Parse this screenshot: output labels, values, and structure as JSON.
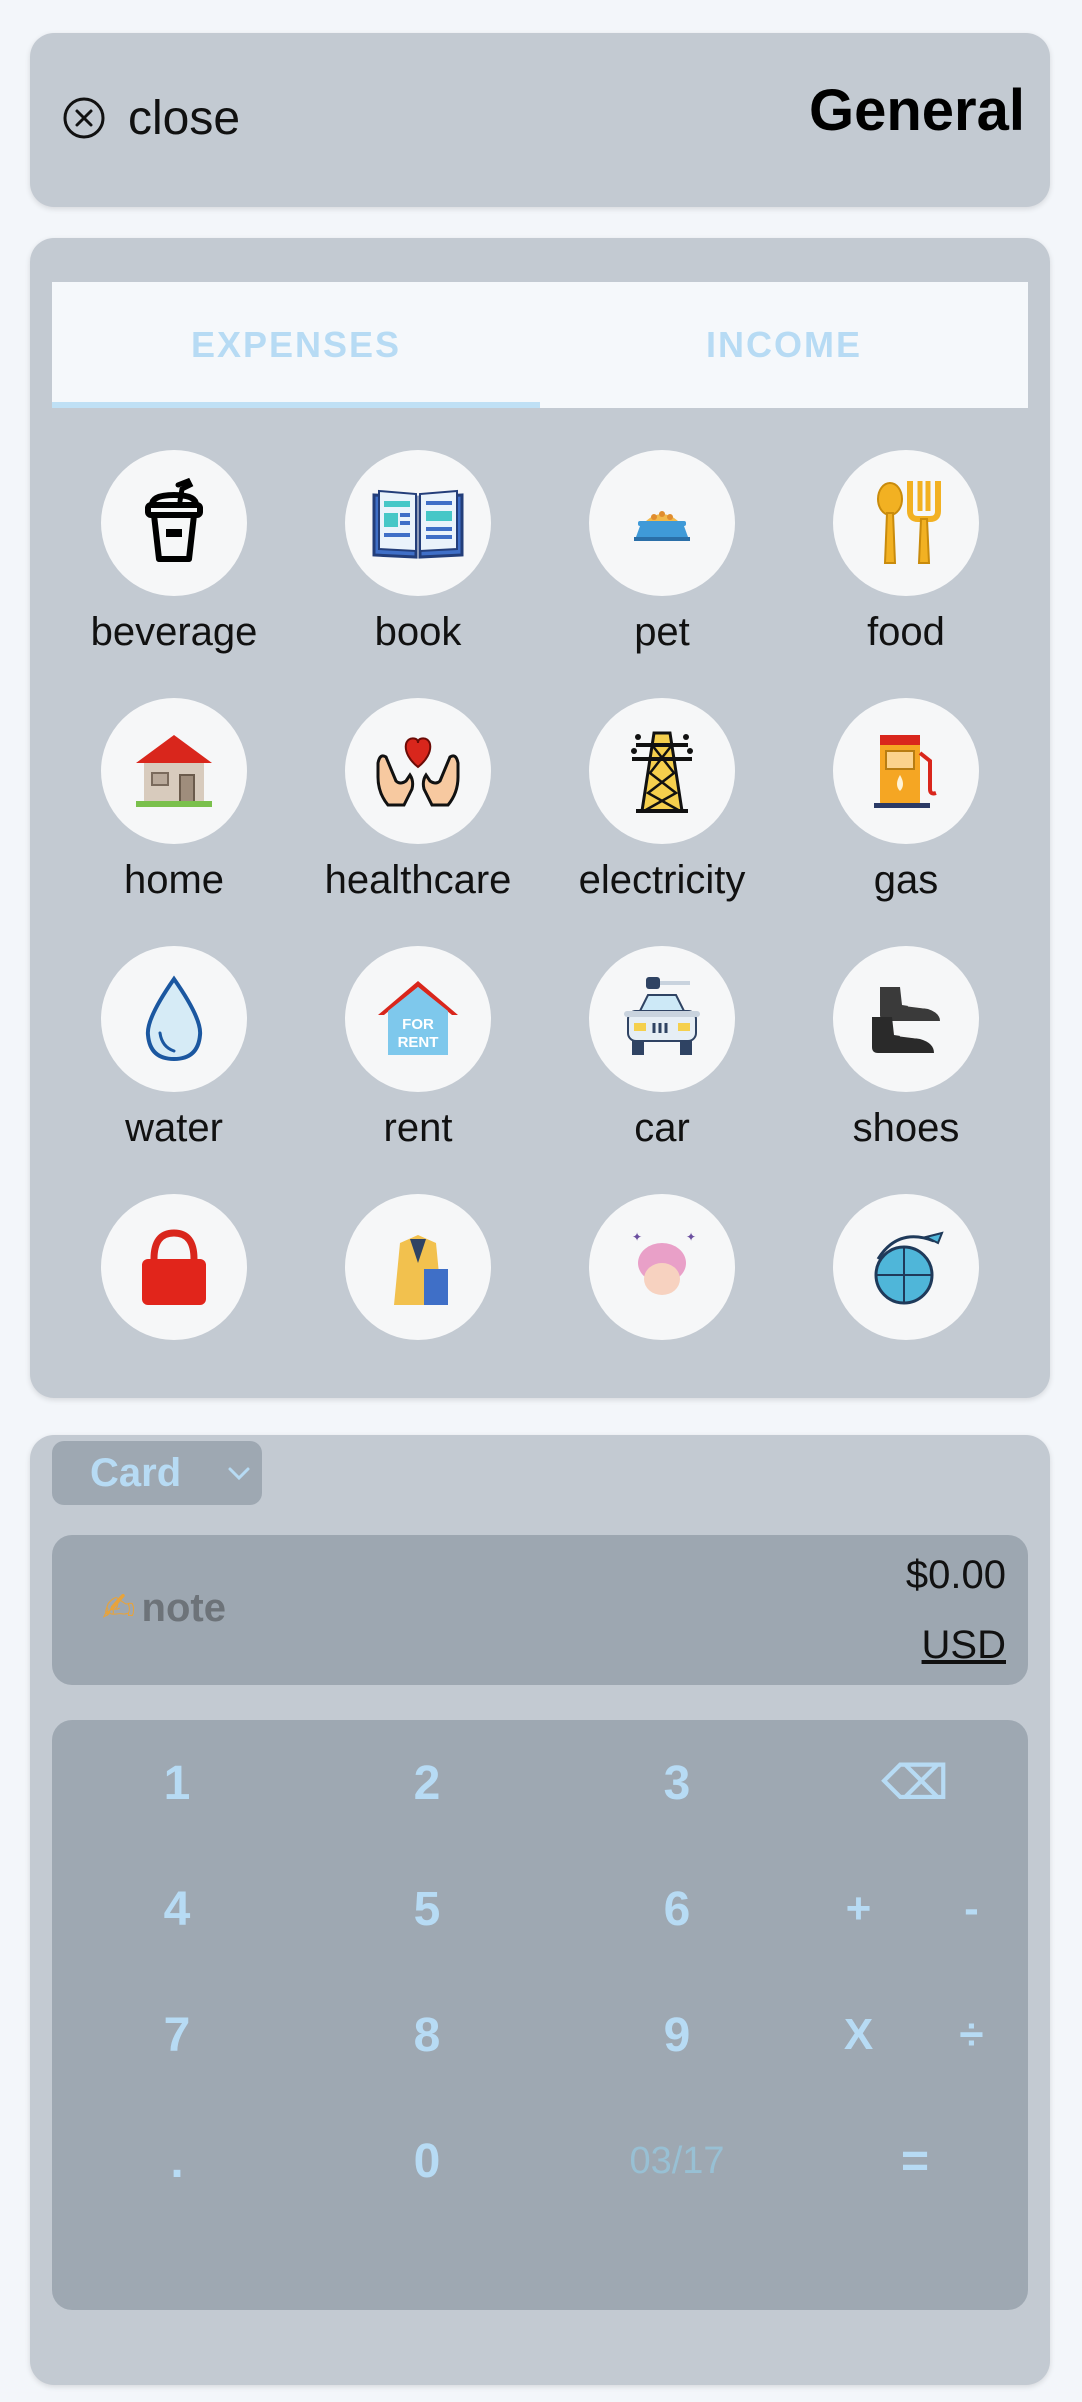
{
  "header": {
    "close_label": "close",
    "title": "General"
  },
  "tabs": [
    {
      "label": "EXPENSES",
      "active": true
    },
    {
      "label": "INCOME",
      "active": false
    }
  ],
  "categories": [
    {
      "name": "beverage",
      "icon": "beverage-icon"
    },
    {
      "name": "book",
      "icon": "book-icon"
    },
    {
      "name": "pet",
      "icon": "pet-bowl-icon"
    },
    {
      "name": "food",
      "icon": "food-utensils-icon"
    },
    {
      "name": "home",
      "icon": "home-icon"
    },
    {
      "name": "healthcare",
      "icon": "healthcare-heart-hands-icon"
    },
    {
      "name": "electricity",
      "icon": "electricity-tower-icon"
    },
    {
      "name": "gas",
      "icon": "gas-pump-icon"
    },
    {
      "name": "water",
      "icon": "water-drop-icon"
    },
    {
      "name": "rent",
      "icon": "rent-house-icon"
    },
    {
      "name": "car",
      "icon": "car-icon"
    },
    {
      "name": "shoes",
      "icon": "shoes-icon"
    },
    {
      "name": "",
      "icon": "bag-icon"
    },
    {
      "name": "",
      "icon": "clothes-icon"
    },
    {
      "name": "",
      "icon": "beauty-icon"
    },
    {
      "name": "",
      "icon": "travel-icon"
    }
  ],
  "rent_sign": {
    "line1": "FOR",
    "line2": "RENT"
  },
  "account": {
    "selected": "Card"
  },
  "entry": {
    "note_icon": "✍",
    "note_placeholder": "note",
    "amount": "$0.00",
    "currency": "USD"
  },
  "keypad": {
    "k1": "1",
    "k2": "2",
    "k3": "3",
    "backspace": "⌫",
    "k4": "4",
    "k5": "5",
    "k6": "6",
    "plus": "+",
    "minus": "-",
    "k7": "7",
    "k8": "8",
    "k9": "9",
    "multiply": "X",
    "divide": "÷",
    "dot": ".",
    "k0": "0",
    "date": "03/17",
    "equals": "="
  },
  "colors": {
    "background": "#f3f6fa",
    "card": "#c3cad2",
    "accent": "#b7dbf4",
    "keypad": "#9ea8b2"
  }
}
